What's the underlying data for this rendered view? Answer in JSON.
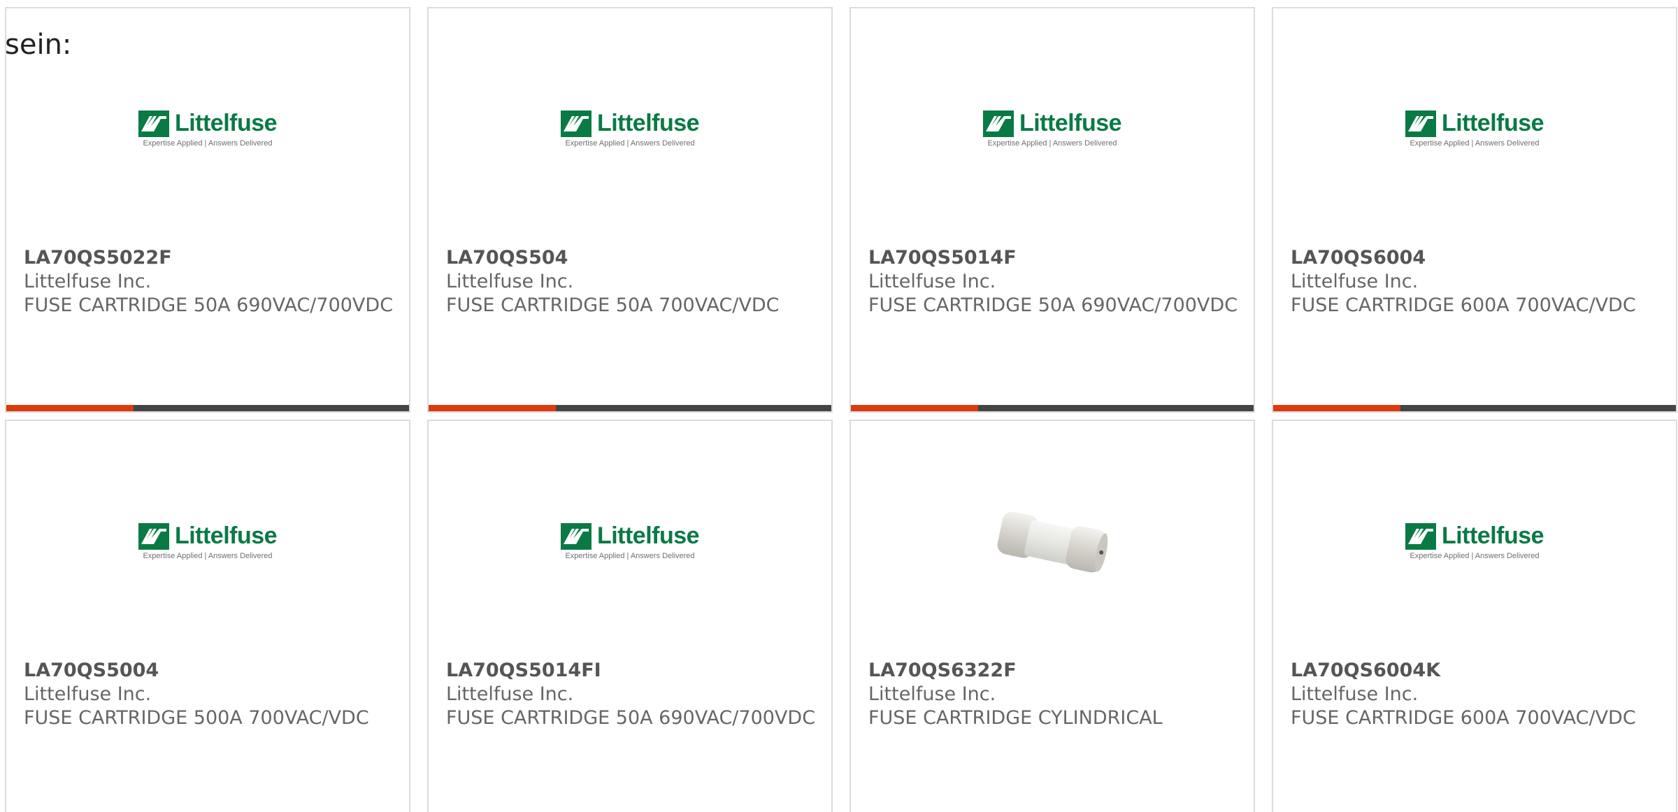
{
  "intro_text": "sein:",
  "logo": {
    "name": "Littelfuse",
    "tagline": "Expertise Applied | Answers Delivered",
    "color": "#0a7a45"
  },
  "accent_colors": {
    "bar_accent": "#dd3a0d",
    "bar_base": "#444444"
  },
  "products": [
    {
      "part_number": "LA70QS5022F",
      "manufacturer": "Littelfuse Inc.",
      "description": "FUSE CARTRIDGE 50A 690VAC/700VDC",
      "image": "littelfuse-logo"
    },
    {
      "part_number": "LA70QS504",
      "manufacturer": "Littelfuse Inc.",
      "description": "FUSE CARTRIDGE 50A 700VAC/VDC",
      "image": "littelfuse-logo"
    },
    {
      "part_number": "LA70QS5014F",
      "manufacturer": "Littelfuse Inc.",
      "description": "FUSE CARTRIDGE 50A 690VAC/700VDC",
      "image": "littelfuse-logo"
    },
    {
      "part_number": "LA70QS6004",
      "manufacturer": "Littelfuse Inc.",
      "description": "FUSE CARTRIDGE 600A 700VAC/VDC",
      "image": "littelfuse-logo"
    },
    {
      "part_number": "LA70QS5004",
      "manufacturer": "Littelfuse Inc.",
      "description": "FUSE CARTRIDGE 500A 700VAC/VDC",
      "image": "littelfuse-logo"
    },
    {
      "part_number": "LA70QS5014FI",
      "manufacturer": "Littelfuse Inc.",
      "description": "FUSE CARTRIDGE 50A 690VAC/700VDC",
      "image": "littelfuse-logo"
    },
    {
      "part_number": "LA70QS6322F",
      "manufacturer": "Littelfuse Inc.",
      "description": "FUSE CARTRIDGE CYLINDRICAL",
      "image": "fuse-cartridge-photo"
    },
    {
      "part_number": "LA70QS6004K",
      "manufacturer": "Littelfuse Inc.",
      "description": "FUSE CARTRIDGE 600A 700VAC/VDC",
      "image": "littelfuse-logo"
    }
  ]
}
